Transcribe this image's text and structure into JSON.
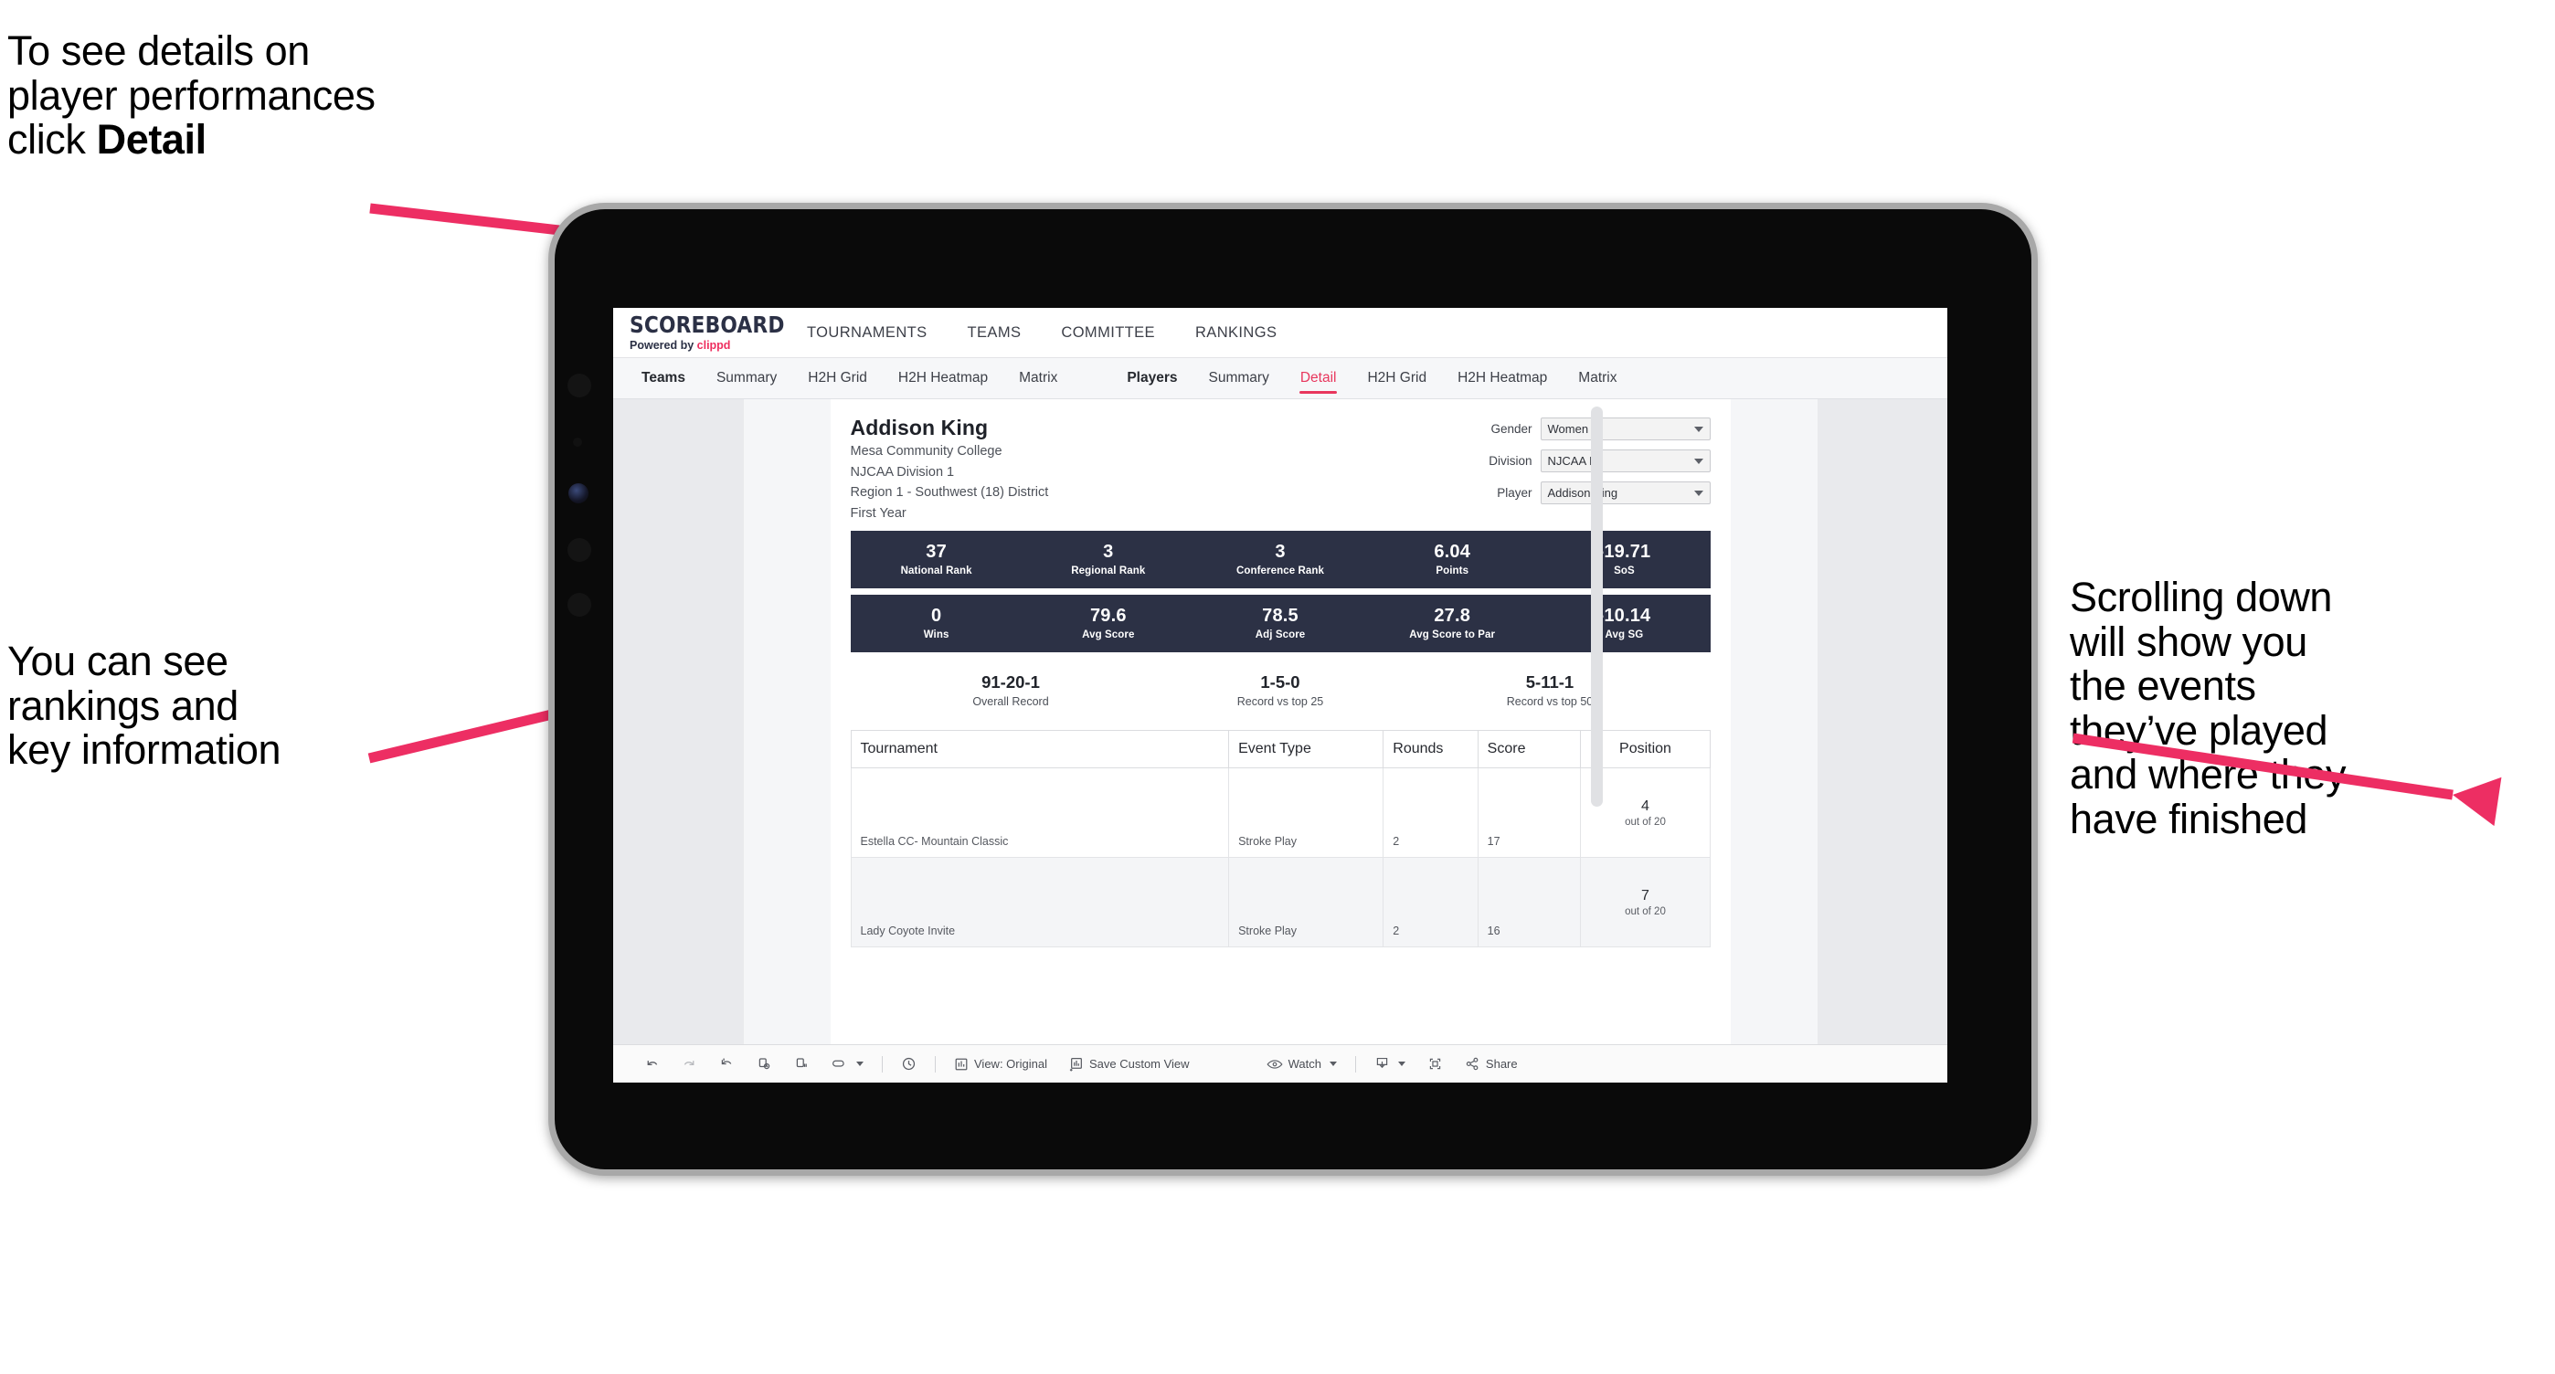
{
  "annotations": {
    "detail_note_pre": "To see details on\nplayer performances\nclick ",
    "detail_note_bold": "Detail",
    "rankings_note": "You can see\nrankings and\nkey information",
    "scroll_note": "Scrolling down\nwill show you\nthe events\nthey’ve played\nand where they\nhave finished"
  },
  "accent_color": "#ed2e63",
  "app": {
    "logo": {
      "main": "SCOREBOARD",
      "sub_prefix": "Powered by ",
      "sub_brand": "clippd"
    },
    "topnav": [
      "TOURNAMENTS",
      "TEAMS",
      "COMMITTEE",
      "RANKINGS"
    ],
    "tabs_teams": {
      "lead": "Teams",
      "items": [
        "Summary",
        "H2H Grid",
        "H2H Heatmap",
        "Matrix"
      ]
    },
    "tabs_players": {
      "lead": "Players",
      "items": [
        "Summary",
        "Detail",
        "H2H Grid",
        "H2H Heatmap",
        "Matrix"
      ],
      "active": "Detail"
    }
  },
  "player": {
    "name": "Addison King",
    "school": "Mesa Community College",
    "division": "NJCAA Division 1",
    "region": "Region 1 - Southwest (18) District",
    "year": "First Year"
  },
  "filters": [
    {
      "label": "Gender",
      "value": "Women"
    },
    {
      "label": "Division",
      "value": "NJCAA I"
    },
    {
      "label": "Player",
      "value": "Addison King"
    }
  ],
  "stats_row1": [
    {
      "value": "37",
      "label": "National Rank"
    },
    {
      "value": "3",
      "label": "Regional Rank"
    },
    {
      "value": "3",
      "label": "Conference Rank"
    },
    {
      "value": "6.04",
      "label": "Points"
    },
    {
      "value": "-19.71",
      "label": "SoS"
    }
  ],
  "stats_row2": [
    {
      "value": "0",
      "label": "Wins"
    },
    {
      "value": "79.6",
      "label": "Avg Score"
    },
    {
      "value": "78.5",
      "label": "Adj Score"
    },
    {
      "value": "27.8",
      "label": "Avg Score to Par"
    },
    {
      "value": "-10.14",
      "label": "Avg SG"
    }
  ],
  "records": [
    {
      "value": "91-20-1",
      "label": "Overall Record"
    },
    {
      "value": "1-5-0",
      "label": "Record vs top 25"
    },
    {
      "value": "5-11-1",
      "label": "Record vs top 50"
    }
  ],
  "table": {
    "headers": [
      "Tournament",
      "Event Type",
      "Rounds",
      "Score",
      "Position"
    ],
    "rows": [
      {
        "tournament": "Estella CC- Mountain Classic",
        "event_type": "Stroke Play",
        "rounds": "2",
        "score": "17",
        "position": "4",
        "out_of": "out of 20"
      },
      {
        "tournament": "Lady Coyote Invite",
        "event_type": "Stroke Play",
        "rounds": "2",
        "score": "16",
        "position": "7",
        "out_of": "out of 20"
      }
    ]
  },
  "toolbar": {
    "view_label": "View: Original",
    "save_label": "Save Custom View",
    "watch_label": "Watch",
    "share_label": "Share"
  }
}
